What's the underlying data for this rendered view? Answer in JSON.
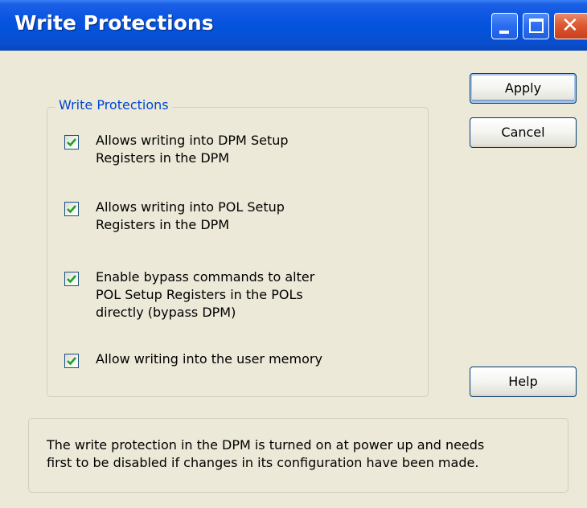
{
  "window": {
    "title": "Write Protections"
  },
  "titlebar_buttons": {
    "minimize_icon": "minimize-icon",
    "maximize_icon": "maximize-icon",
    "close_icon": "close-icon",
    "close_glyph": "✕"
  },
  "group": {
    "legend": "Write Protections",
    "items": [
      {
        "label": "Allows writing into DPM Setup\nRegisters in the DPM",
        "checked": true
      },
      {
        "label": "Allows writing into POL Setup\nRegisters in the DPM",
        "checked": true
      },
      {
        "label": "Enable bypass commands to alter\nPOL Setup Registers in the POLs\ndirectly (bypass DPM)",
        "checked": true
      },
      {
        "label": "Allow writing into the user memory",
        "checked": true
      }
    ]
  },
  "buttons": {
    "apply": "Apply",
    "cancel": "Cancel",
    "help": "Help"
  },
  "info": {
    "text": "The write protection in the DPM is turned on at power up and needs\nfirst to be disabled if changes in its configuration have been made."
  },
  "colors": {
    "titlebar": "#0854e0",
    "dialog_background": "#ece9d8",
    "legend_text": "#0046d5",
    "checkmark": "#21a121"
  }
}
